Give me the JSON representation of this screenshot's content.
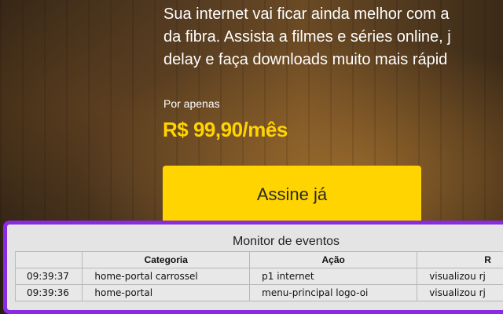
{
  "hero": {
    "description_lines": [
      "Sua internet vai ficar ainda melhor com a",
      "da fibra. Assista a filmes e séries online, j",
      "delay e faça downloads muito mais rápid"
    ],
    "price_caption": "Por apenas",
    "price": "R$ 99,90/mês",
    "cta_label": "Assine já"
  },
  "monitor": {
    "title": "Monitor de eventos",
    "columns": [
      "",
      "Categoria",
      "Ação",
      "R"
    ],
    "rows": [
      {
        "time": "09:39:37",
        "categoria": "home-portal carrossel",
        "acao": "p1 internet",
        "rotulo": "visualizou rj"
      },
      {
        "time": "09:39:36",
        "categoria": "home-portal",
        "acao": "menu-principal logo-oi",
        "rotulo": "visualizou rj"
      }
    ]
  },
  "colors": {
    "accent_yellow": "#ffd400",
    "monitor_border": "#8a2be2",
    "monitor_bg": "#e4e4e4"
  }
}
